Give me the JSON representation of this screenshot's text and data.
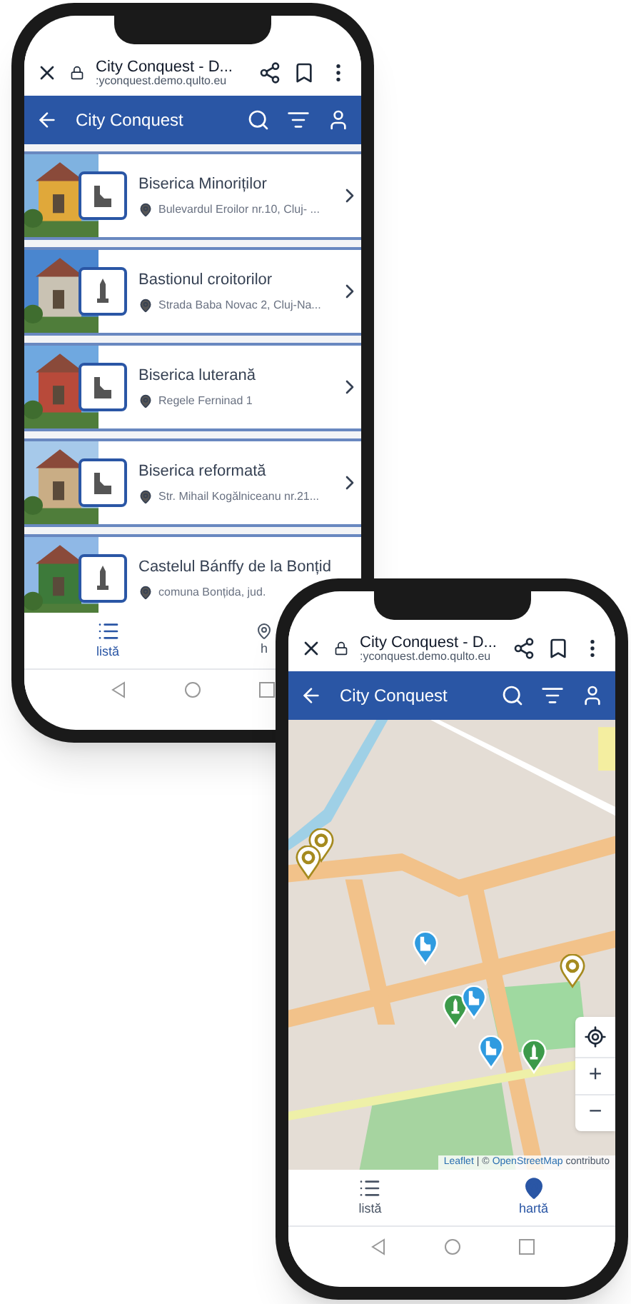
{
  "phones": [
    {
      "browser": {
        "title": "City Conquest - D...",
        "url": ":yconquest.demo.qulto.eu"
      },
      "app_bar": {
        "title": "City Conquest"
      },
      "items": [
        {
          "name": "Biserica Minoriților",
          "address": "Bulevardul Eroilor nr.10, Cluj- ...",
          "kind": "church"
        },
        {
          "name": "Bastionul croitorilor",
          "address": "Strada Baba Novac 2, Cluj-Na...",
          "kind": "monument"
        },
        {
          "name": "Biserica luterană",
          "address": "Regele Ferninad 1",
          "kind": "church"
        },
        {
          "name": "Biserica reformată",
          "address": "Str. Mihail Kogălniceanu nr.21...",
          "kind": "church"
        },
        {
          "name": "Castelul Bánffy de la Bonțid",
          "address": "comuna Bonțida, jud.",
          "kind": "monument"
        }
      ],
      "nav": [
        {
          "label": "listă",
          "kind": "list",
          "selected": true
        },
        {
          "label": "h",
          "kind": "map",
          "selected": false
        }
      ]
    },
    {
      "browser": {
        "title": "City Conquest - D...",
        "url": ":yconquest.demo.qulto.eu"
      },
      "app_bar": {
        "title": "City Conquest"
      },
      "markers": [
        {
          "kind": "gold"
        },
        {
          "kind": "gold"
        },
        {
          "kind": "church"
        },
        {
          "kind": "gold"
        },
        {
          "kind": "monument"
        },
        {
          "kind": "church"
        },
        {
          "kind": "church"
        },
        {
          "kind": "monument"
        }
      ],
      "map_controls": {
        "zoom_in": "+",
        "zoom_out": "−"
      },
      "attribution": {
        "leaflet": "Leaflet",
        "separator": "| ©",
        "osm": "OpenStreetMap",
        "rest": "contributo"
      },
      "nav": [
        {
          "label": "listă",
          "kind": "list",
          "selected": false
        },
        {
          "label": "hartă",
          "kind": "map",
          "selected": true
        }
      ]
    }
  ]
}
